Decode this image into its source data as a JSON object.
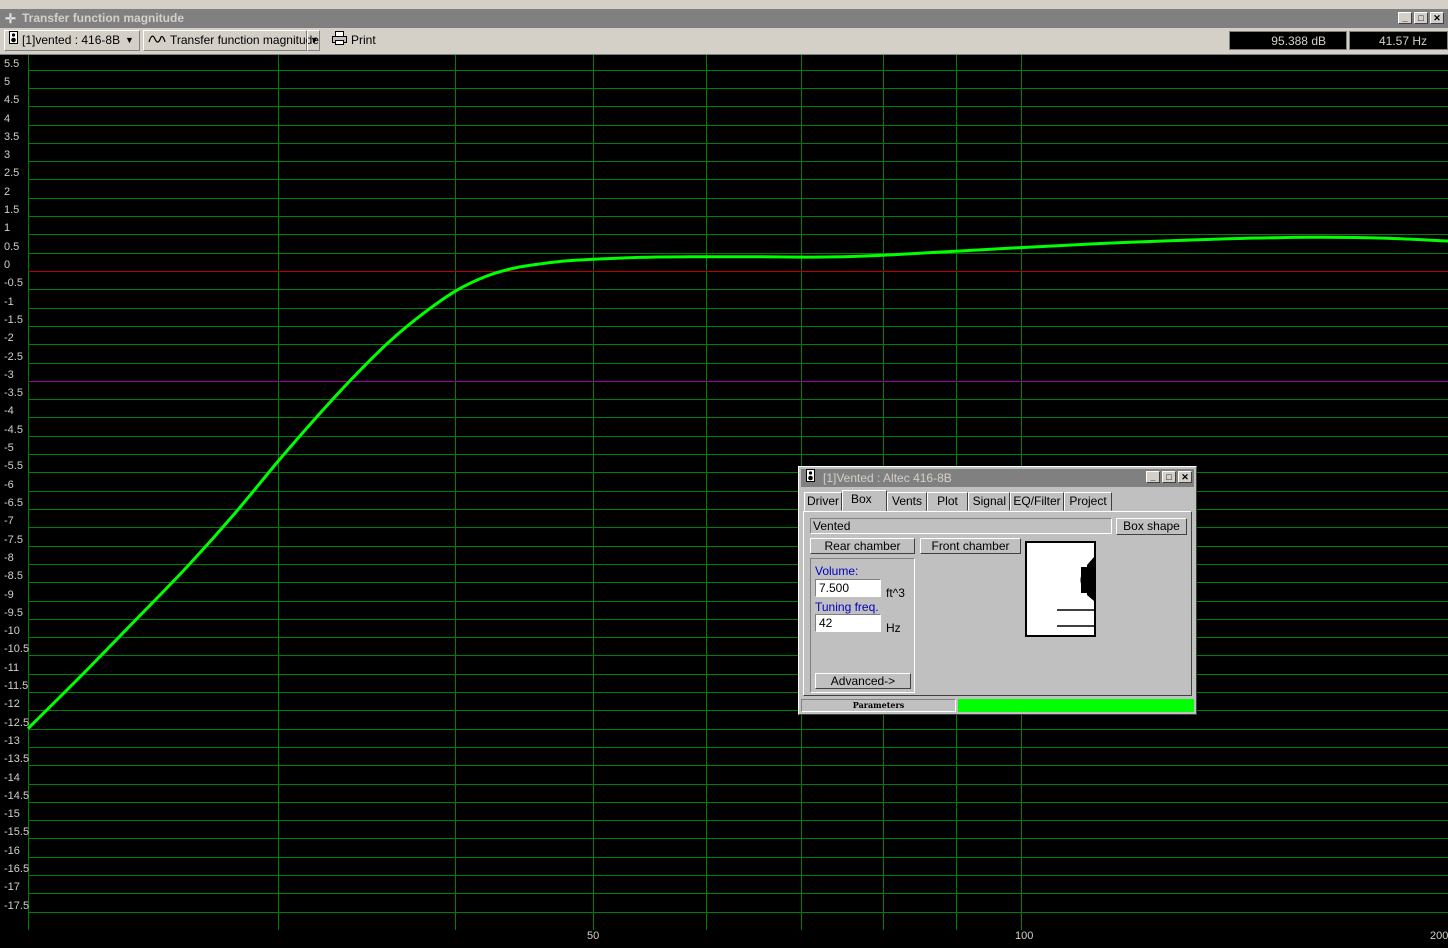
{
  "window": {
    "title": "Transfer function magnitude",
    "buttons": [
      "_",
      "□",
      "✕"
    ]
  },
  "toolbar": {
    "driver_select": "[1]vented : 416-8B",
    "plot_select": "Transfer function magnitude",
    "print_label": "Print",
    "readout_db": "95.388 dB",
    "readout_hz": "41.57 Hz"
  },
  "chart_data": {
    "type": "line",
    "title": "",
    "xlabel": "",
    "ylabel": "",
    "x_scale": "log",
    "xlim": [
      20,
      200
    ],
    "ylim": [
      -18,
      5.9
    ],
    "x_tick_labels": [
      {
        "x": 50,
        "label": "50"
      },
      {
        "x": 100,
        "label": "100"
      },
      {
        "x": 200,
        "label": "200"
      }
    ],
    "x_gridlines": [
      30,
      40,
      50,
      60,
      70,
      80,
      90,
      100,
      200
    ],
    "y_ticks": [
      5.5,
      5,
      4.5,
      4,
      3.5,
      3,
      2.5,
      2,
      1.5,
      1,
      0.5,
      0,
      -0.5,
      -1,
      -1.5,
      -2,
      -2.5,
      -3,
      -3.5,
      -4,
      -4.5,
      -5,
      -5.5,
      -6,
      -6.5,
      -7,
      -7.5,
      -8,
      -8.5,
      -9,
      -9.5,
      -10,
      -10.5,
      -11,
      -11.5,
      -12,
      -12.5,
      -13,
      -13.5,
      -14,
      -14.5,
      -15,
      -15.5,
      -16,
      -16.5,
      -17,
      -17.5
    ],
    "reference_lines": [
      {
        "y": 0,
        "color": "#c00000"
      },
      {
        "y": -3,
        "color": "#a000a0"
      }
    ],
    "grid": true,
    "background": "#000000",
    "grid_color": "#008000",
    "series": [
      {
        "color": "#00ff00",
        "x": [
          20,
          22,
          24,
          26,
          28,
          30,
          32,
          34,
          36,
          38,
          40,
          42,
          44,
          46,
          48,
          50,
          52,
          55,
          60,
          65,
          70,
          75,
          80,
          90,
          100,
          110,
          120,
          140,
          160,
          180,
          200
        ],
        "y": [
          -12.5,
          -10.9,
          -9.4,
          -8.0,
          -6.6,
          -5.2,
          -3.95,
          -2.85,
          -1.9,
          -1.15,
          -0.55,
          -0.15,
          0.08,
          0.2,
          0.28,
          0.32,
          0.35,
          0.38,
          0.39,
          0.39,
          0.38,
          0.39,
          0.43,
          0.54,
          0.64,
          0.72,
          0.79,
          0.88,
          0.92,
          0.9,
          0.82
        ]
      }
    ]
  },
  "dialog": {
    "title": "[1]Vented : Altec 416-8B",
    "tabs": [
      "Driver",
      "Box",
      "Vents",
      "Plot",
      "Signal",
      "EQ/Filter",
      "Project"
    ],
    "active_tab": "Box",
    "box_type": "Vented",
    "box_shape_button": "Box shape",
    "rear_chamber_button": "Rear chamber",
    "front_chamber_button": "Front chamber",
    "volume_label": "Volume:",
    "volume_value": "7.500",
    "volume_unit": "ft^3",
    "tuning_label": "Tuning freq.",
    "tuning_value": "42",
    "tuning_unit": "Hz",
    "advanced_button": "Advanced->",
    "status_label": "Parameters"
  }
}
